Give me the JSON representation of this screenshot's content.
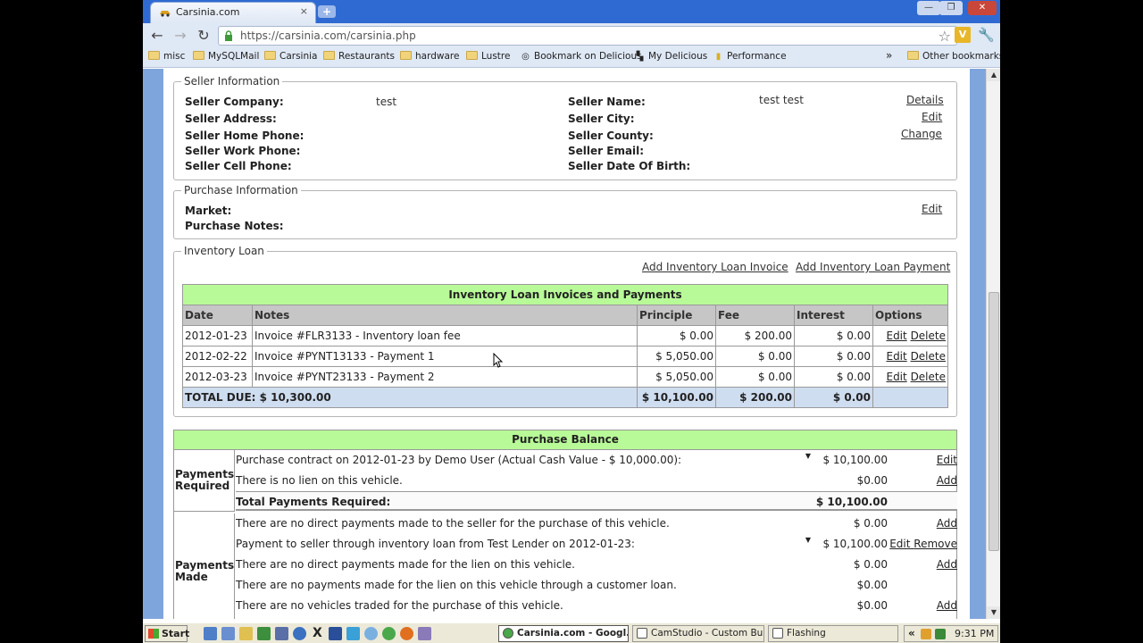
{
  "browser": {
    "tab_title": "Carsinia.com",
    "tab_close": "×",
    "new_tab": "+",
    "url": "https://carsinia.com/carsinia.php",
    "bookmarks": [
      {
        "label": "misc",
        "kind": "folder"
      },
      {
        "label": "MySQLMail",
        "kind": "folder"
      },
      {
        "label": "Carsinia",
        "kind": "folder"
      },
      {
        "label": "Restaurants",
        "kind": "folder"
      },
      {
        "label": "hardware",
        "kind": "folder"
      },
      {
        "label": "Lustre",
        "kind": "folder"
      },
      {
        "label": "Bookmark on Delicious",
        "kind": "link"
      },
      {
        "label": "My Delicious",
        "kind": "link"
      },
      {
        "label": "Performance",
        "kind": "link"
      }
    ],
    "bookmarks_overflow": "»",
    "other_bookmarks": "Other bookmarks"
  },
  "seller": {
    "legend": "Seller Information",
    "company_label": "Seller Company:",
    "company_value": "test",
    "address_label": "Seller Address:",
    "home_phone_label": "Seller Home Phone:",
    "work_phone_label": "Seller Work Phone:",
    "cell_phone_label": "Seller Cell Phone:",
    "name_label": "Seller Name:",
    "name_value": "test test",
    "city_label": "Seller City:",
    "county_label": "Seller County:",
    "email_label": "Seller Email:",
    "dob_label": "Seller Date Of Birth:",
    "details_link": "Details",
    "edit_link": "Edit",
    "change_link": "Change"
  },
  "purchase": {
    "legend": "Purchase Information",
    "market_label": "Market:",
    "notes_label": "Purchase Notes:",
    "edit_link": "Edit"
  },
  "inventory_loan": {
    "legend": "Inventory Loan",
    "add_invoice_link": "Add Inventory Loan Invoice",
    "add_payment_link": "Add Inventory Loan Payment",
    "table_title": "Inventory Loan Invoices and Payments",
    "columns": [
      "Date",
      "Notes",
      "Principle",
      "Fee",
      "Interest",
      "Options"
    ],
    "rows": [
      {
        "date": "2012-01-23",
        "notes": "Invoice #FLR3133 - Inventory loan fee",
        "principle": "$ 0.00",
        "fee": "$ 200.00",
        "interest": "$ 0.00",
        "edit": "Edit",
        "delete": "Delete"
      },
      {
        "date": "2012-02-22",
        "notes": "Invoice #PYNT13133 - Payment 1",
        "principle": "$ 5,050.00",
        "fee": "$ 0.00",
        "interest": "$ 0.00",
        "edit": "Edit",
        "delete": "Delete"
      },
      {
        "date": "2012-03-23",
        "notes": "Invoice #PYNT23133 - Payment 2",
        "principle": "$ 5,050.00",
        "fee": "$ 0.00",
        "interest": "$ 0.00",
        "edit": "Edit",
        "delete": "Delete"
      }
    ],
    "total_label": "TOTAL DUE: $ 10,300.00",
    "total_principle": "$ 10,100.00",
    "total_fee": "$ 200.00",
    "total_interest": "$ 0.00"
  },
  "purchase_balance": {
    "title": "Purchase Balance",
    "required_label": "Payments Required",
    "required_rows": [
      {
        "text": "Purchase contract on 2012-01-23 by Demo User (Actual Cash Value - $ 10,000.00):",
        "amount": "$ 10,100.00",
        "action": "Edit",
        "dropdown": true
      },
      {
        "text": "There is no lien on this vehicle.",
        "amount": "$0.00",
        "action": "Add",
        "dropdown": false
      }
    ],
    "required_total_label": "Total Payments Required:",
    "required_total_value": "$ 10,100.00",
    "made_label": "Payments Made",
    "made_rows": [
      {
        "text": "There are no direct payments made to the seller for the purchase of this vehicle.",
        "amount": "$ 0.00",
        "action": "Add",
        "action2": ""
      },
      {
        "text": "Payment to seller through inventory loan from Test Lender on 2012-01-23:",
        "amount": "$ 10,100.00",
        "action": "Edit",
        "action2": "Remove"
      },
      {
        "text": "There are no direct payments made for the lien on this vehicle.",
        "amount": "$ 0.00",
        "action": "Add",
        "action2": ""
      },
      {
        "text": "There are no payments made for the lien on this vehicle through a customer loan.",
        "amount": "$0.00",
        "action": "",
        "action2": ""
      },
      {
        "text": "There are no vehicles traded for the purchase of this vehicle.",
        "amount": "$0.00",
        "action": "Add",
        "action2": ""
      }
    ]
  },
  "taskbar": {
    "start": "Start",
    "tasks": [
      "Carsinia.com - Googl...",
      "CamStudio - Custom Build",
      "Flashing"
    ],
    "tray_arrows": "«",
    "clock": "9:31 PM"
  }
}
